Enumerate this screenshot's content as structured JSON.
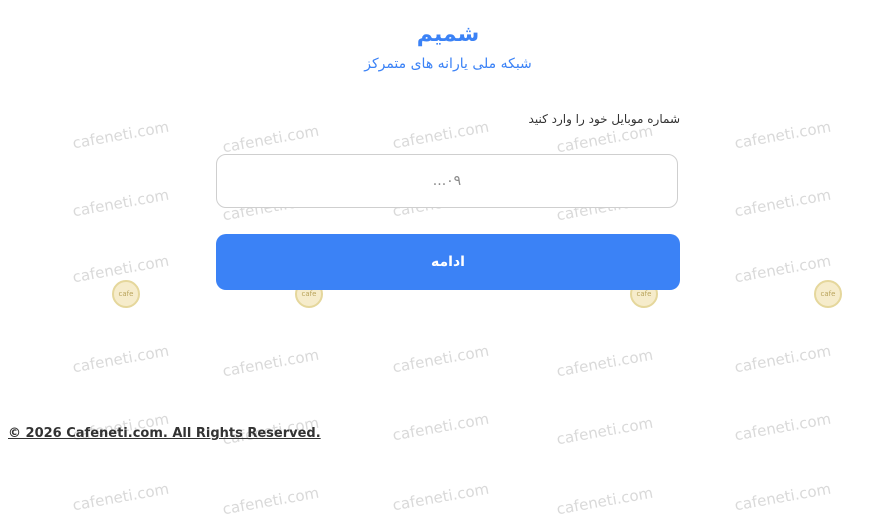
{
  "header": {
    "title": "شمیم",
    "subtitle": "شبکه ملی یارانه های متمرکز"
  },
  "form": {
    "phone_label": "شماره موبایل خود را وارد کنید",
    "phone_placeholder": "۰۹...",
    "phone_value": "",
    "continue_label": "ادامه"
  },
  "footer": {
    "copyright": "© 2026 Cafeneti.com. All Rights Reserved."
  },
  "watermark": {
    "text": "cafeneti.com",
    "logo_text": "cafe"
  },
  "colors": {
    "accent": "#3b82f6",
    "text": "#333333",
    "border": "#cfcfcf",
    "watermark": "#d9d9d9"
  }
}
